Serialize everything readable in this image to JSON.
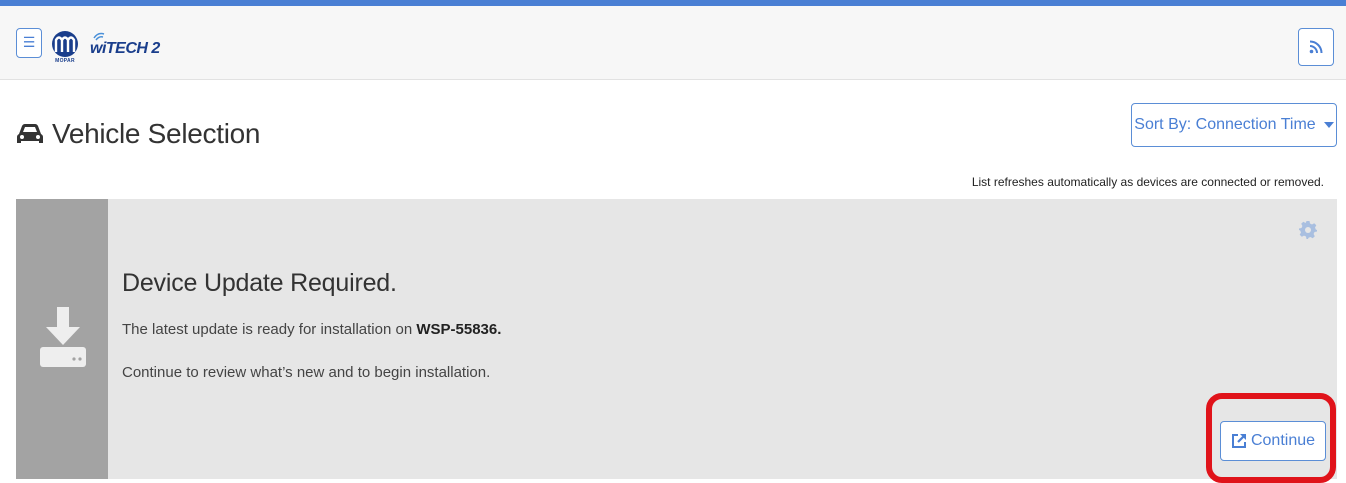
{
  "header": {
    "menu_icon": "hamburger-icon",
    "brand_small": "MOPAR",
    "brand_text": "wiTECH 2",
    "rss_icon": "rss-icon",
    "accent_color": "#4a7fd4"
  },
  "page": {
    "title_icon": "car-icon",
    "title": "Vehicle Selection",
    "sort_label": "Sort By: Connection Time",
    "refresh_note": "List refreshes automatically as devices are connected or removed."
  },
  "card": {
    "icon": "download-icon",
    "settings_icon": "gear-icon",
    "title": "Device Update Required.",
    "line1_prefix": "The latest update is ready for installation on ",
    "device_id": "WSP-55836.",
    "line2": "Continue to review what’s new and to begin installation.",
    "continue_label": "Continue",
    "continue_icon": "external-link-icon"
  }
}
